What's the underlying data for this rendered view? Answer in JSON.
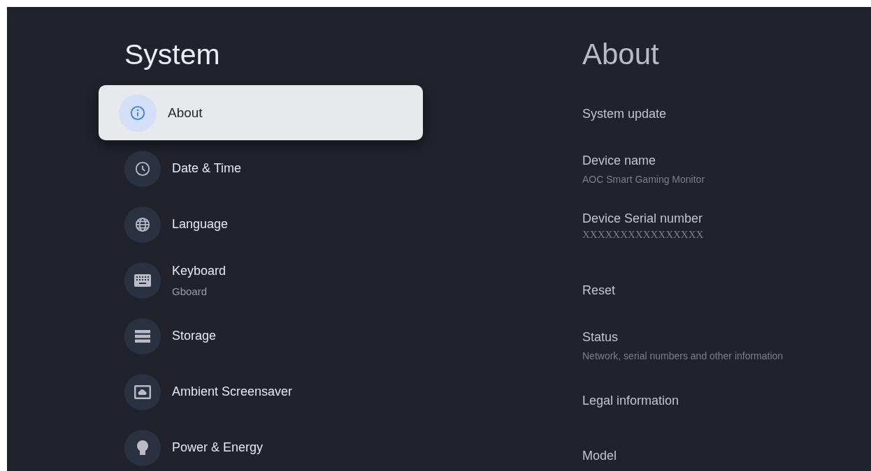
{
  "left": {
    "title": "System",
    "items": [
      {
        "label": "About",
        "selected": true
      },
      {
        "label": "Date & Time",
        "selected": false
      },
      {
        "label": "Language",
        "selected": false
      },
      {
        "label": "Keyboard",
        "subtitle": "Gboard",
        "selected": false
      },
      {
        "label": "Storage",
        "selected": false
      },
      {
        "label": "Ambient Screensaver",
        "selected": false
      },
      {
        "label": "Power & Energy",
        "selected": false
      }
    ]
  },
  "right": {
    "title": "About",
    "items": [
      {
        "label": "System update"
      },
      {
        "label": "Device name",
        "subtitle": "AOC Smart Gaming Monitor"
      },
      {
        "label": "Device Serial number",
        "subtitle": "XXXXXXXXXXXXXXXX",
        "kind": "serial"
      },
      {
        "label": "Reset"
      },
      {
        "label": "Status",
        "subtitle": "Network, serial numbers and other information"
      },
      {
        "label": "Legal information"
      },
      {
        "label": "Model"
      }
    ]
  }
}
